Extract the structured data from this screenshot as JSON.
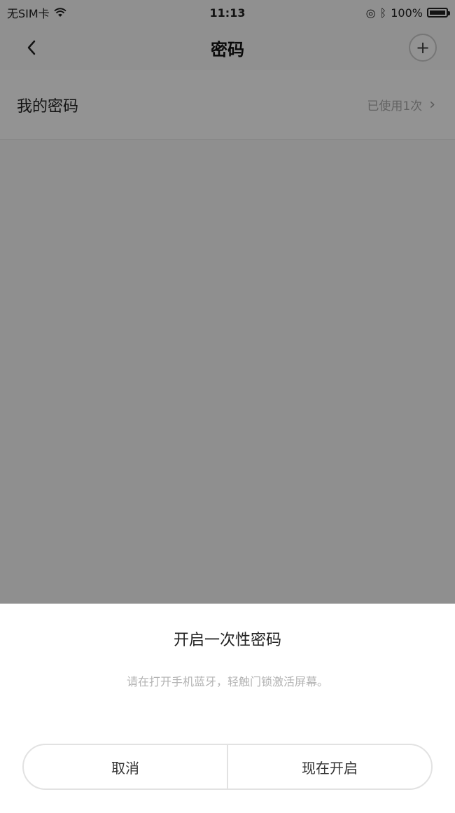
{
  "status_bar": {
    "carrier": "无SIM卡",
    "time": "11:13",
    "battery": "100%"
  },
  "nav": {
    "back_icon": "chevron-left-icon",
    "title": "密码",
    "add_icon": "plus-icon",
    "add_glyph": "+"
  },
  "list": {
    "rows": [
      {
        "label": "我的密码",
        "value": "已使用1次",
        "chevron": "›"
      }
    ]
  },
  "sheet": {
    "title": "开启一次性密码",
    "description": "请在打开手机蓝牙，轻触门锁激活屏幕。",
    "cancel_label": "取消",
    "confirm_label": "现在开启"
  },
  "colors": {
    "overlay": "#000000",
    "sheet_bg": "#ffffff",
    "button_border": "#e2e2e2",
    "description_text": "#b3b3b3"
  }
}
